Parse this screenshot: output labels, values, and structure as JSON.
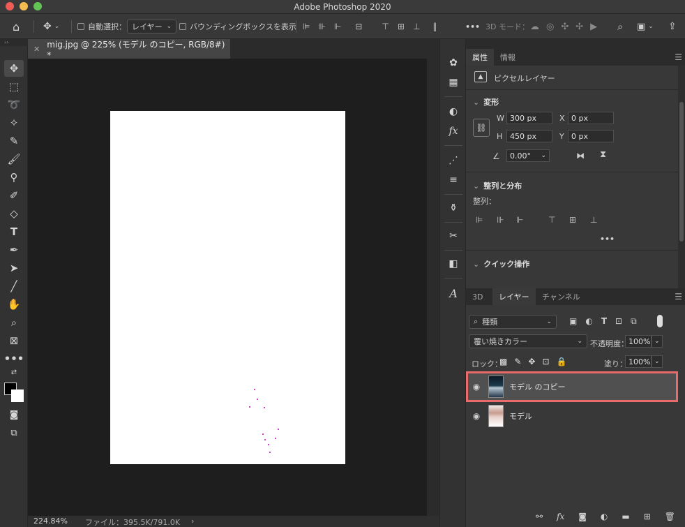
{
  "window": {
    "title": "Adobe Photoshop 2020"
  },
  "options_bar": {
    "auto_select_label": "自動選択：",
    "auto_select_value": "レイヤー",
    "bounding_box_label": "バウンディングボックスを表示",
    "more": "•••",
    "mode_3d_label": "3D モード："
  },
  "document": {
    "tab_label": "mig.jpg @ 225% (モデル のコピー, RGB/8#) *"
  },
  "status": {
    "zoom": "224.84%",
    "file_info": "ファイル：395.5K/791.0K"
  },
  "properties_panel": {
    "tabs": [
      "属性",
      "情報"
    ],
    "layer_type": "ピクセルレイヤー",
    "transform": {
      "header": "変形",
      "w_label": "W",
      "w": "300 px",
      "h_label": "H",
      "h": "450 px",
      "x_label": "X",
      "x": "0 px",
      "y_label": "Y",
      "y": "0 px",
      "angle": "0.00°"
    },
    "align": {
      "header": "整列と分布",
      "label": "整列：",
      "more": "•••"
    },
    "quick_actions": {
      "header": "クイック操作"
    }
  },
  "layers_panel": {
    "tabs": [
      "3D",
      "レイヤー",
      "チャンネル"
    ],
    "filter_kind": "種類",
    "blend_mode": "覆い焼きカラー",
    "opacity_label": "不透明度：",
    "opacity": "100%",
    "lock_label": "ロック：",
    "fill_label": "塗り：",
    "fill": "100%",
    "layers": [
      {
        "name": "モデル のコピー",
        "selected": true
      },
      {
        "name": "モデル",
        "selected": false
      }
    ]
  },
  "colors": {
    "highlight": "#e96b6b",
    "canvas": "#ffffff",
    "speck": "#d43bd0"
  }
}
